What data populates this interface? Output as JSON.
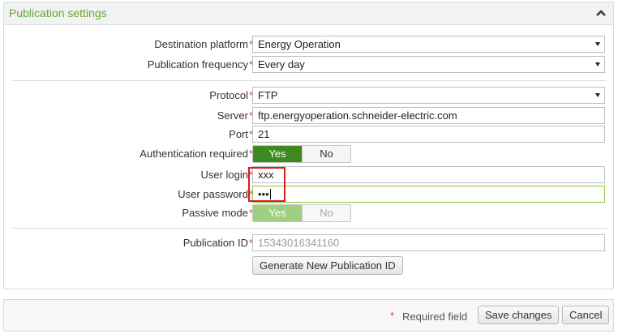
{
  "panel": {
    "title": "Publication settings",
    "collapse_icon": "chevron-up-icon"
  },
  "required_mark": "*",
  "fields": {
    "destination_platform": {
      "label": "Destination platform",
      "value": "Energy Operation"
    },
    "publication_frequency": {
      "label": "Publication frequency",
      "value": "Every day"
    },
    "protocol": {
      "label": "Protocol",
      "value": "FTP"
    },
    "server": {
      "label": "Server",
      "value": "ftp.energyoperation.schneider-electric.com"
    },
    "port": {
      "label": "Port",
      "value": "21"
    },
    "authentication_required": {
      "label": "Authentication required",
      "on_label": "Yes",
      "off_label": "No",
      "selected": "Yes"
    },
    "user_login": {
      "label": "User login",
      "value": "xxx"
    },
    "user_password": {
      "label": "User password",
      "value": "•••"
    },
    "passive_mode": {
      "label": "Passive mode",
      "on_label": "Yes",
      "off_label": "No",
      "selected": "Yes",
      "enabled": false
    },
    "publication_id": {
      "label": "Publication ID",
      "value": "15343016341160"
    }
  },
  "buttons": {
    "generate_id": "Generate New Publication ID",
    "save": "Save changes",
    "cancel": "Cancel"
  },
  "footer": {
    "required_note": "Required field"
  },
  "colors": {
    "accent_green": "#62a82c",
    "toggle_on": "#3f8a1f",
    "required_red": "#e0443d",
    "highlight_red": "#e0181e"
  }
}
